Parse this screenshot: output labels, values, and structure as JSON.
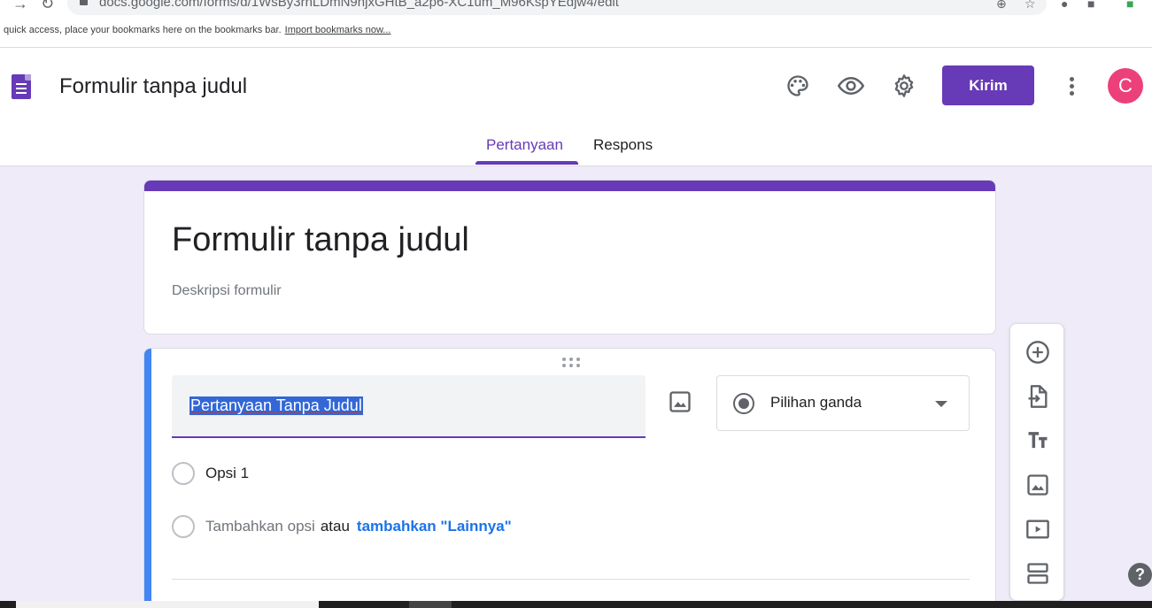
{
  "browser": {
    "url": "docs.google.com/forms/d/1WsBy3rhLDmN9njxGHtB_a2p6-XC1um_M96KspYEdjw4/edit",
    "bookmarks_text": "quick access, place your bookmarks here on the bookmarks bar.",
    "bookmarks_link": "Import bookmarks now..."
  },
  "header": {
    "title": "Formulir tanpa judul",
    "send_label": "Kirim",
    "avatar_initial": "C",
    "avatar_color": "#ec407a",
    "accent_color": "#673ab7",
    "icons": [
      "palette-icon",
      "preview-eye-icon",
      "settings-gear-icon",
      "more-vert-icon"
    ]
  },
  "tabs": [
    {
      "label": "Pertanyaan",
      "active": true
    },
    {
      "label": "Respons",
      "active": false
    }
  ],
  "form": {
    "title": "Formulir tanpa judul",
    "description_placeholder": "Deskripsi formulir"
  },
  "question": {
    "title": "Pertanyaan Tanpa Judul",
    "type": "Pilihan ganda",
    "options": [
      {
        "label": "Opsi 1"
      }
    ],
    "add_option_placeholder": "Tambahkan opsi",
    "or_text": "atau",
    "add_other_link": "tambahkan \"Lainnya\""
  },
  "side_toolbar": [
    "add-question-icon",
    "import-questions-icon",
    "add-title-text-icon",
    "add-image-icon",
    "add-video-icon",
    "add-section-icon"
  ],
  "help_label": "?"
}
